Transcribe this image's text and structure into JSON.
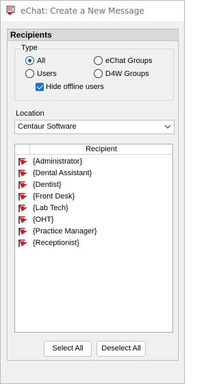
{
  "window": {
    "title": "eChat: Create a New Message"
  },
  "panel": {
    "header": "Recipients"
  },
  "type_group": {
    "label": "Type",
    "options": [
      {
        "label": "All",
        "checked": true
      },
      {
        "label": "eChat Groups",
        "checked": false
      },
      {
        "label": "Users",
        "checked": false
      },
      {
        "label": "D4W Groups",
        "checked": false
      }
    ],
    "hide_offline": {
      "label": "Hide offline users",
      "checked": true
    }
  },
  "location": {
    "label": "Location",
    "value": "Centaur Software"
  },
  "recipients": {
    "column_header": "Recipient",
    "items": [
      "{Administrator}",
      "{Dental Assistant}",
      "{Dentist}",
      "{Front Desk}",
      "{Lab Tech}",
      "{OHT}",
      "{Practice Manager}",
      "{Receptionist}"
    ]
  },
  "buttons": {
    "select_all": "Select All",
    "deselect_all": "Deselect All"
  },
  "colors": {
    "accent": "#005fb8",
    "checkbox": "#1a73c9",
    "panel_header": "#d9d9d9",
    "brand_red": "#d01c24"
  }
}
